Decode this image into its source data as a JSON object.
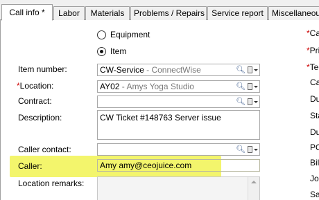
{
  "tabs": [
    {
      "label": "Call info *"
    },
    {
      "label": "Labor"
    },
    {
      "label": "Materials"
    },
    {
      "label": "Problems / Repairs"
    },
    {
      "label": "Service report"
    },
    {
      "label": "Miscellaneous"
    }
  ],
  "form": {
    "radio_equipment": "Equipment",
    "radio_item": "Item",
    "selected_radio": "Item",
    "item_number_label": "Item number:",
    "item_number_code": "CW-Service",
    "item_number_name": " - ConnectWise",
    "location_req": "*",
    "location_label": "Location:",
    "location_code": "AY02",
    "location_name": " - Amys Yoga Studio",
    "contract_label": "Contract:",
    "contract_value": "",
    "description_label": "Description:",
    "description_value": "CW Ticket #148763 Server issue",
    "caller_contact_label": "Caller contact:",
    "caller_contact_value": "",
    "caller_label": "Caller:",
    "caller_value": "Amy amy@ceojuice.com",
    "location_remarks_label": "Location remarks:",
    "location_remarks_value": ""
  },
  "right_labels": [
    {
      "req": "*",
      "text": "Cal"
    },
    {
      "req": "*",
      "text": "Pri"
    },
    {
      "req": "*",
      "text": "Tec"
    },
    {
      "req": "",
      "text": "Cal"
    },
    {
      "req": "",
      "text": "Du"
    },
    {
      "req": "",
      "text": "Sta"
    },
    {
      "req": "",
      "text": "Du"
    },
    {
      "req": "",
      "text": "PO"
    },
    {
      "req": "",
      "text": "Bill"
    },
    {
      "req": "",
      "text": "Job"
    },
    {
      "req": "",
      "text": "Sal"
    }
  ],
  "colors": {
    "highlight": "#f3f56c",
    "required": "#cc0000"
  },
  "icons": [
    "search-icon",
    "contact-book-icon",
    "dropdown-arrow-icon",
    "scroll-up-icon"
  ]
}
